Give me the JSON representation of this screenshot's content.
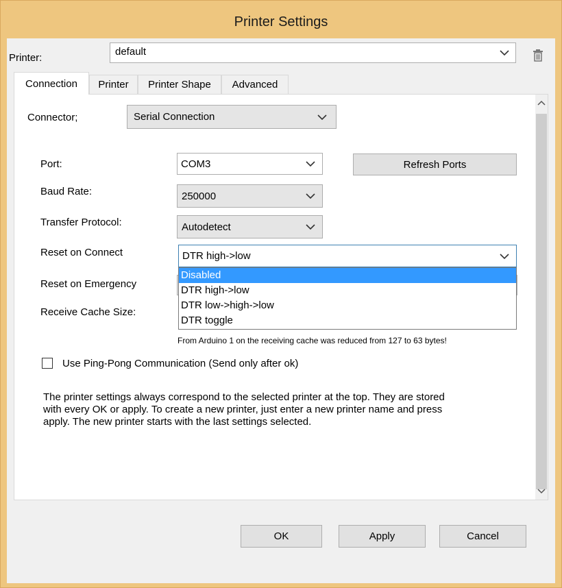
{
  "window": {
    "title": "Printer Settings"
  },
  "printer": {
    "label": "Printer:",
    "value": "default"
  },
  "tabs": [
    {
      "label": "Connection"
    },
    {
      "label": "Printer"
    },
    {
      "label": "Printer Shape"
    },
    {
      "label": "Advanced"
    }
  ],
  "connection": {
    "connector_label": "Connector;",
    "connector_value": "Serial Connection",
    "port_label": "Port:",
    "port_value": "COM3",
    "refresh_label": "Refresh Ports",
    "baud_label": "Baud Rate:",
    "baud_value": "250000",
    "protocol_label": "Transfer Protocol:",
    "protocol_value": "Autodetect",
    "reset_connect_label": "Reset on Connect",
    "reset_connect_value": "DTR high->low",
    "reset_connect_options": [
      "Disabled",
      "DTR high->low",
      "DTR low->high->low",
      "DTR toggle"
    ],
    "reset_connect_highlighted": "Disabled",
    "reset_emergency_label": "Reset on Emergency",
    "cache_label": "Receive Cache Size:",
    "cache_note": "From Arduino 1 on the receiving cache was reduced from 127 to 63 bytes!",
    "pingpong_label": "Use Ping-Pong Communication (Send only after ok)",
    "pingpong_checked": false,
    "info_text": "The printer settings always correspond to the selected printer at the top. They are stored with every OK or apply. To create a new printer, just enter a new printer name and press apply. The new printer starts with the last settings selected."
  },
  "buttons": {
    "ok": "OK",
    "apply": "Apply",
    "cancel": "Cancel"
  },
  "icons": {
    "delete": "trash-icon",
    "dropdown": "chevron-down-icon",
    "scroll_up": "chevron-up-icon",
    "scroll_down": "chevron-down-icon"
  },
  "colors": {
    "titlebar": "#eec67f",
    "selection": "#3399ff",
    "dialog": "#f0f0f0"
  }
}
